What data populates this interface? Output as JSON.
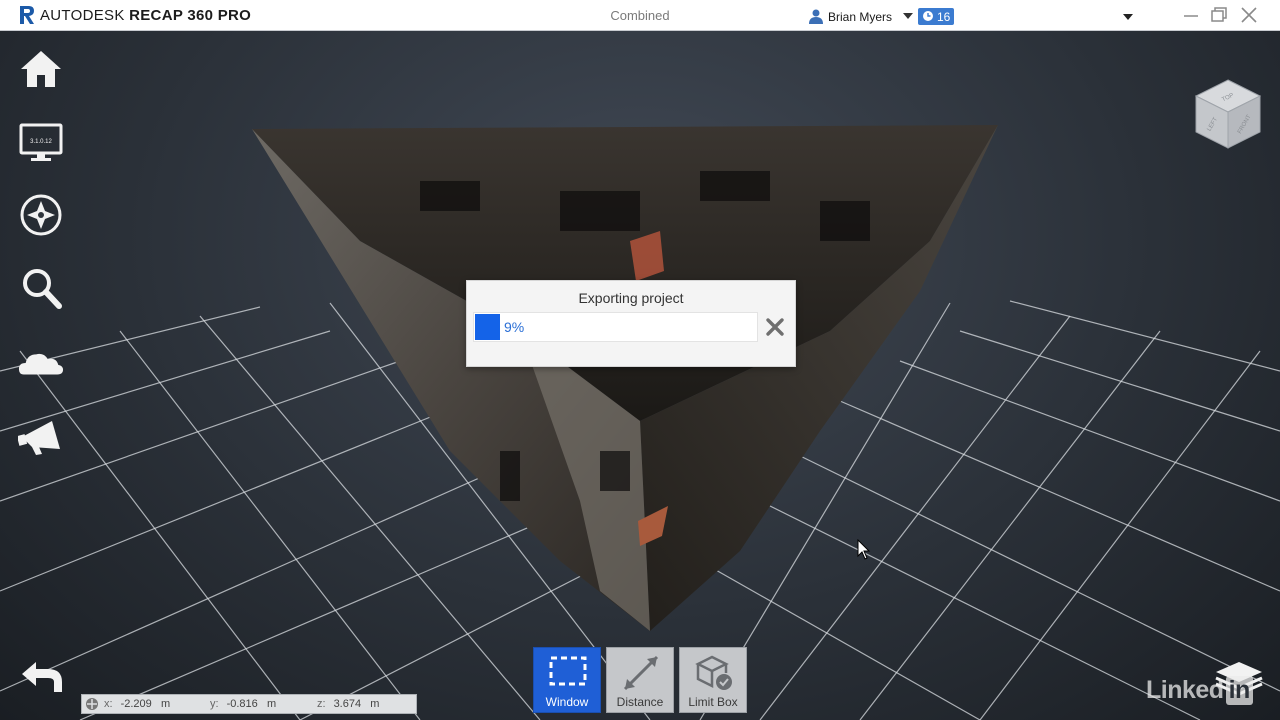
{
  "titlebar": {
    "brand": "AUTODESK",
    "product": "RECAP 360 PRO",
    "project_name": "Combined",
    "user_name": "Brian Myers",
    "notification_count": "16"
  },
  "sidebar": {
    "items": [
      {
        "icon": "home-icon"
      },
      {
        "icon": "monitor-icon",
        "label": "3.1.0.12"
      },
      {
        "icon": "compass-icon"
      },
      {
        "icon": "search-icon"
      },
      {
        "icon": "cloud-icon"
      },
      {
        "icon": "megaphone-icon"
      }
    ]
  },
  "viewcube": {
    "top": "TOP",
    "left": "LEFT",
    "front": "FRONT"
  },
  "dialog": {
    "title": "Exporting project",
    "progress_percent": 9,
    "progress_text": "9%"
  },
  "toolbar": {
    "buttons": [
      {
        "label": "Window",
        "active": true
      },
      {
        "label": "Distance",
        "active": false
      },
      {
        "label": "Limit Box",
        "active": false
      }
    ]
  },
  "coordinates": {
    "x_label": "x:",
    "x_value": "-2.209",
    "x_unit": "m",
    "y_label": "y:",
    "y_value": "-0.816",
    "y_unit": "m",
    "z_label": "z:",
    "z_value": "3.674",
    "z_unit": "m"
  },
  "watermark": {
    "text": "Linked",
    "suffix": "in"
  },
  "colors": {
    "accent": "#1f5fd6",
    "progress": "#1463e8",
    "badge": "#3b7bd0"
  }
}
